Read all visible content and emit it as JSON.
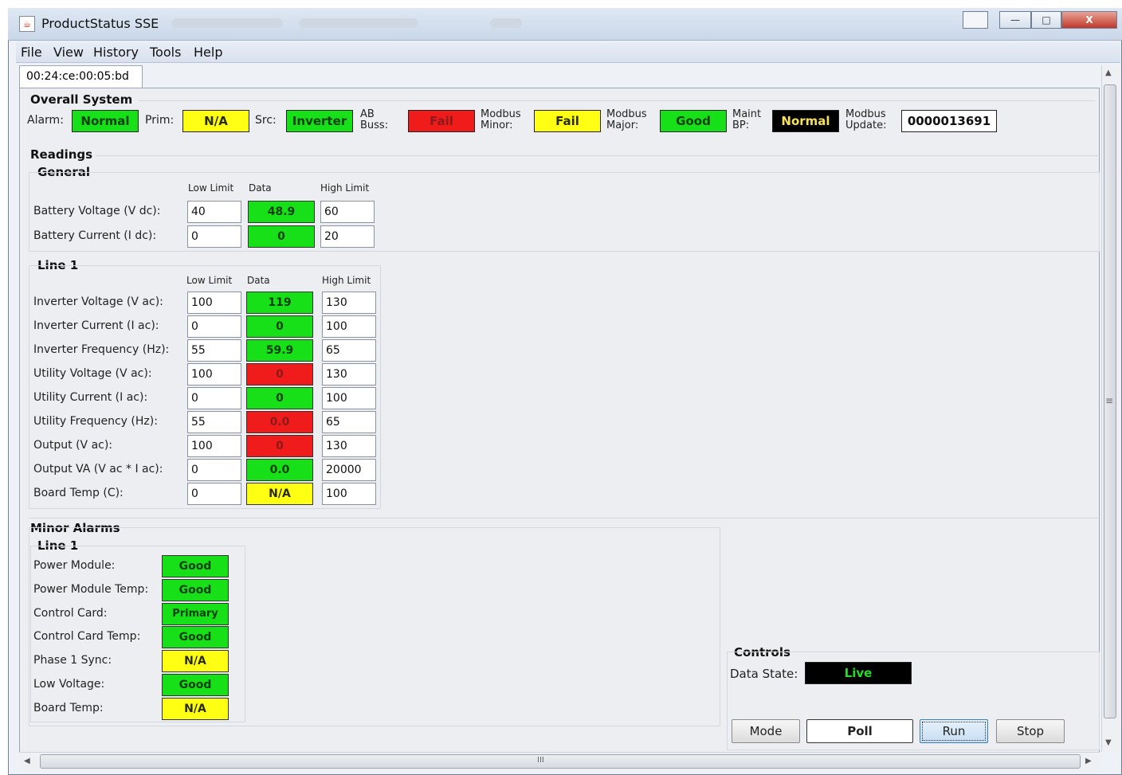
{
  "window": {
    "title": "ProductStatus SSE",
    "controls": {
      "minimize": "—",
      "restore": "□",
      "close": "X"
    }
  },
  "menu": [
    "File",
    "View",
    "History",
    "Tools",
    "Help"
  ],
  "tab_label": "00:24:ce:00:05:bd",
  "overall": {
    "title": "Overall System",
    "alarm_label": "Alarm:",
    "alarm_value": "Normal",
    "prim_label": "Prim:",
    "prim_value": "N/A",
    "src_label": "Src:",
    "src_value": "Inverter",
    "ab_buss_label_1": "AB",
    "ab_buss_label_2": "Buss:",
    "ab_buss_value": "Fail",
    "modbus_minor_label_1": "Modbus",
    "modbus_minor_label_2": "Minor:",
    "modbus_minor_value": "Fail",
    "modbus_major_label_1": "Modbus",
    "modbus_major_label_2": "Major:",
    "modbus_major_value": "Good",
    "maint_bp_label_1": "Maint",
    "maint_bp_label_2": "BP:",
    "maint_bp_value": "Normal",
    "modbus_update_label_1": "Modbus",
    "modbus_update_label_2": "Update:",
    "modbus_update_value": "0000013691"
  },
  "readings": {
    "title": "Readings",
    "general": {
      "title": "General",
      "headers": {
        "low": "Low Limit",
        "data": "Data",
        "high": "High Limit"
      },
      "rows": [
        {
          "label": "Battery Voltage (V dc):",
          "low": "40",
          "data": "48.9",
          "high": "60",
          "status": "green"
        },
        {
          "label": "Battery Current (I dc):",
          "low": "0",
          "data": "0",
          "high": "20",
          "status": "green"
        }
      ]
    },
    "line1": {
      "title": "Line 1",
      "headers": {
        "low": "Low Limit",
        "data": "Data",
        "high": "High Limit"
      },
      "rows": [
        {
          "label": "Inverter Voltage (V ac):",
          "low": "100",
          "data": "119",
          "high": "130",
          "status": "green"
        },
        {
          "label": "Inverter Current (I ac):",
          "low": "0",
          "data": "0",
          "high": "100",
          "status": "green"
        },
        {
          "label": "Inverter Frequency (Hz):",
          "low": "55",
          "data": "59.9",
          "high": "65",
          "status": "green"
        },
        {
          "label": "Utility Voltage (V ac):",
          "low": "100",
          "data": "0",
          "high": "130",
          "status": "red"
        },
        {
          "label": "Utility Current (I ac):",
          "low": "0",
          "data": "0",
          "high": "100",
          "status": "green"
        },
        {
          "label": "Utility Frequency (Hz):",
          "low": "55",
          "data": "0.0",
          "high": "65",
          "status": "red"
        },
        {
          "label": "Output (V ac):",
          "low": "100",
          "data": "0",
          "high": "130",
          "status": "red"
        },
        {
          "label": "Output VA (V ac * I ac):",
          "low": "0",
          "data": "0.0",
          "high": "20000",
          "status": "green"
        },
        {
          "label": "Board Temp (C):",
          "low": "0",
          "data": "N/A",
          "high": "100",
          "status": "yellow"
        }
      ]
    }
  },
  "minor_alarms": {
    "title": "Minor Alarms",
    "line1_title": "Line 1",
    "rows": [
      {
        "label": "Power Module:",
        "value": "Good",
        "status": "green"
      },
      {
        "label": "Power Module Temp:",
        "value": "Good",
        "status": "green"
      },
      {
        "label": "Control Card:",
        "value": "Primary",
        "status": "green"
      },
      {
        "label": "Control Card Temp:",
        "value": "Good",
        "status": "green"
      },
      {
        "label": "Phase 1 Sync:",
        "value": "N/A",
        "status": "yellow"
      },
      {
        "label": "Low Voltage:",
        "value": "Good",
        "status": "green"
      },
      {
        "label": "Board Temp:",
        "value": "N/A",
        "status": "yellow"
      }
    ]
  },
  "controls": {
    "title": "Controls",
    "data_state_label": "Data State:",
    "data_state_value": "Live",
    "buttons": {
      "mode": "Mode",
      "poll": "Poll",
      "run": "Run",
      "stop": "Stop"
    }
  },
  "scroll": {
    "hthumb_grip": "III",
    "vthumb_grip": "≡"
  },
  "colors": {
    "green": "#18e018",
    "yellow": "#ffff14",
    "red": "#f01b1b",
    "black": "#000000"
  }
}
